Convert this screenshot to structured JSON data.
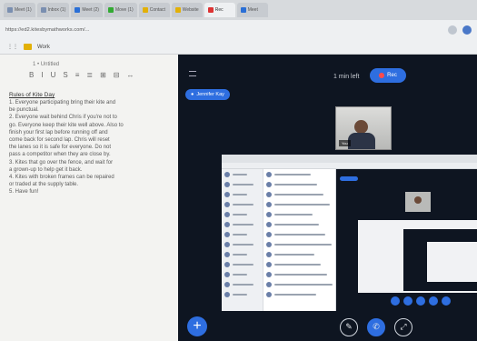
{
  "browser": {
    "tabs": [
      {
        "label": "Meet (1)",
        "color": "gray"
      },
      {
        "label": "Inbox (1)",
        "color": "gray"
      },
      {
        "label": "Meet (2)",
        "color": "blue"
      },
      {
        "label": "Move (1)",
        "color": "green"
      },
      {
        "label": "Contact",
        "color": "yellow"
      },
      {
        "label": "Website",
        "color": "yellow"
      },
      {
        "label": "Rec",
        "color": "red"
      },
      {
        "label": "Meet",
        "color": "blue"
      }
    ],
    "url": "https://ed2.kitesbymathworks.com/...",
    "bookmark_label": "Work"
  },
  "doc": {
    "toolbar": [
      "B",
      "I",
      "U",
      "S",
      "≡",
      "≣",
      "⊞",
      "⊟",
      "↔"
    ],
    "small_label": "1 • Untitled",
    "heading": "Rules of Kite Day",
    "lines": [
      "1. Everyone participating bring their kite and",
      "be punctual.",
      "2. Everyone wait behind Chris if you're not to",
      "go. Everyone keep their kite well above. Also to",
      "finish your first lap before running off and",
      "come back for second lap. Chris will reset",
      "the lanes so it is safe for everyone. Do not",
      "pass a competitor when they are close by.",
      "3. Kites that go over the fence, and wait for",
      "a grown-up to help get it back.",
      "4. Kites with broken frames can be repaired",
      "or traded at the supply table.",
      "5. Have fun!"
    ]
  },
  "meeting": {
    "elapsed": "1 min left",
    "record_label": "Rec",
    "speaker": "Jennifer Kay",
    "cam_tag": "You",
    "add_button": "+",
    "controls": [
      "✎",
      "✆",
      "⤢"
    ]
  }
}
